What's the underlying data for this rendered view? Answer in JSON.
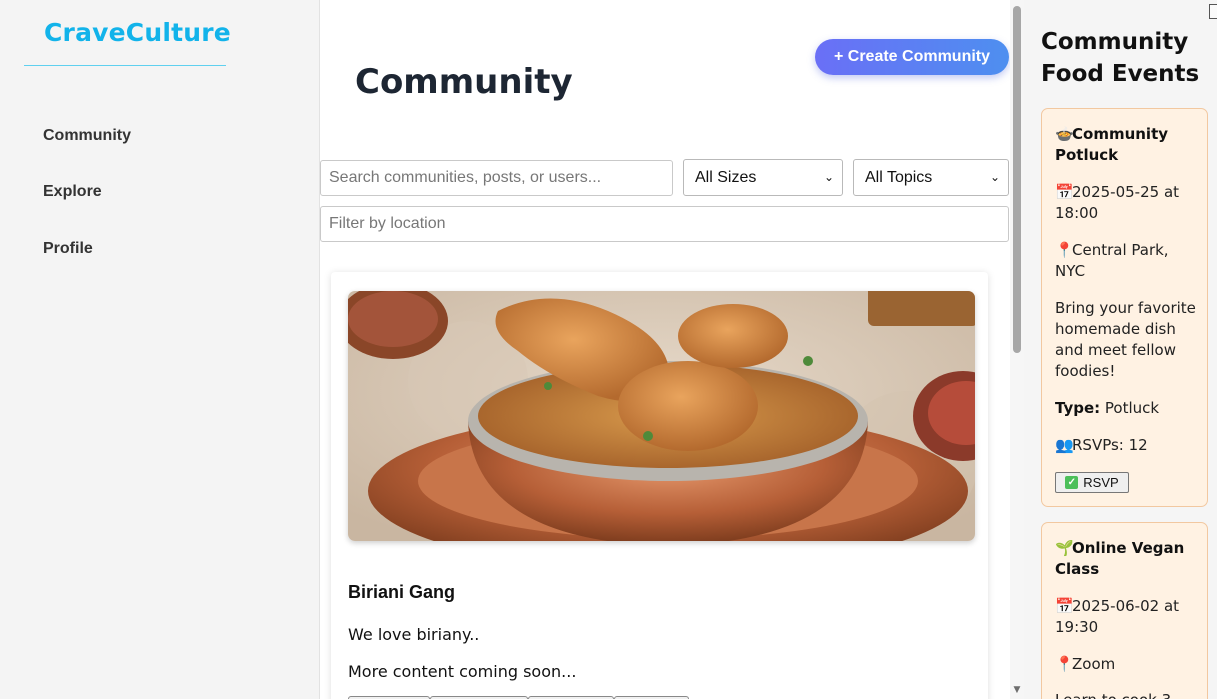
{
  "brand": {
    "name": "CraveCulture",
    "color": "#12b3ea"
  },
  "nav": [
    {
      "label": "Community"
    },
    {
      "label": "Explore"
    },
    {
      "label": "Profile"
    }
  ],
  "main": {
    "title": "Community",
    "create_button": "+ Create Community",
    "search_placeholder": "Search communities, posts, or users...",
    "size_filter": {
      "selected": "All Sizes"
    },
    "topic_filter": {
      "selected": "All Topics"
    },
    "location_placeholder": "Filter by location"
  },
  "card": {
    "title": "Biriani Gang",
    "description": "We love biriany..",
    "more": "More content coming soon..."
  },
  "events_panel": {
    "title": "Community Food Events",
    "events": [
      {
        "title": "Community Potluck",
        "datetime": "2025-05-25 at 18:00",
        "location": "Central Park, NYC",
        "description": "Bring your favorite homemade dish and meet fellow foodies!",
        "type_label": "Type:",
        "type": "Potluck",
        "rsvps": "RSVPs: 12",
        "rsvp_button": "RSVP"
      },
      {
        "title": "Online Vegan Class",
        "datetime": "2025-06-02 at 19:30",
        "location": "Zoom",
        "description": "Learn to cook 3"
      }
    ]
  }
}
